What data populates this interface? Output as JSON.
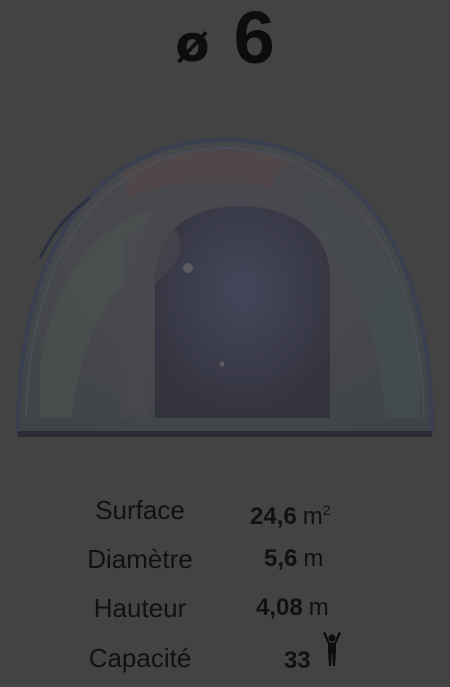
{
  "header": {
    "symbol": "ø",
    "value": "6"
  },
  "illustration": {
    "name": "dome-illustration",
    "colors": {
      "outline": "#3a3f52",
      "base": "#2a2d33",
      "glass": "#505055",
      "interior": "#3b3b49"
    }
  },
  "specs": {
    "surface": {
      "label": "Surface",
      "value": "24,6",
      "unit": "m",
      "unit_suffix": "2"
    },
    "diameter": {
      "label": "Diamètre",
      "value": "5,6",
      "unit": "m"
    },
    "height": {
      "label": "Hauteur",
      "value": "4,08",
      "unit": "m"
    },
    "capacity": {
      "label": "Capacité",
      "value": "33",
      "icon": "person-arms-up-icon"
    }
  }
}
